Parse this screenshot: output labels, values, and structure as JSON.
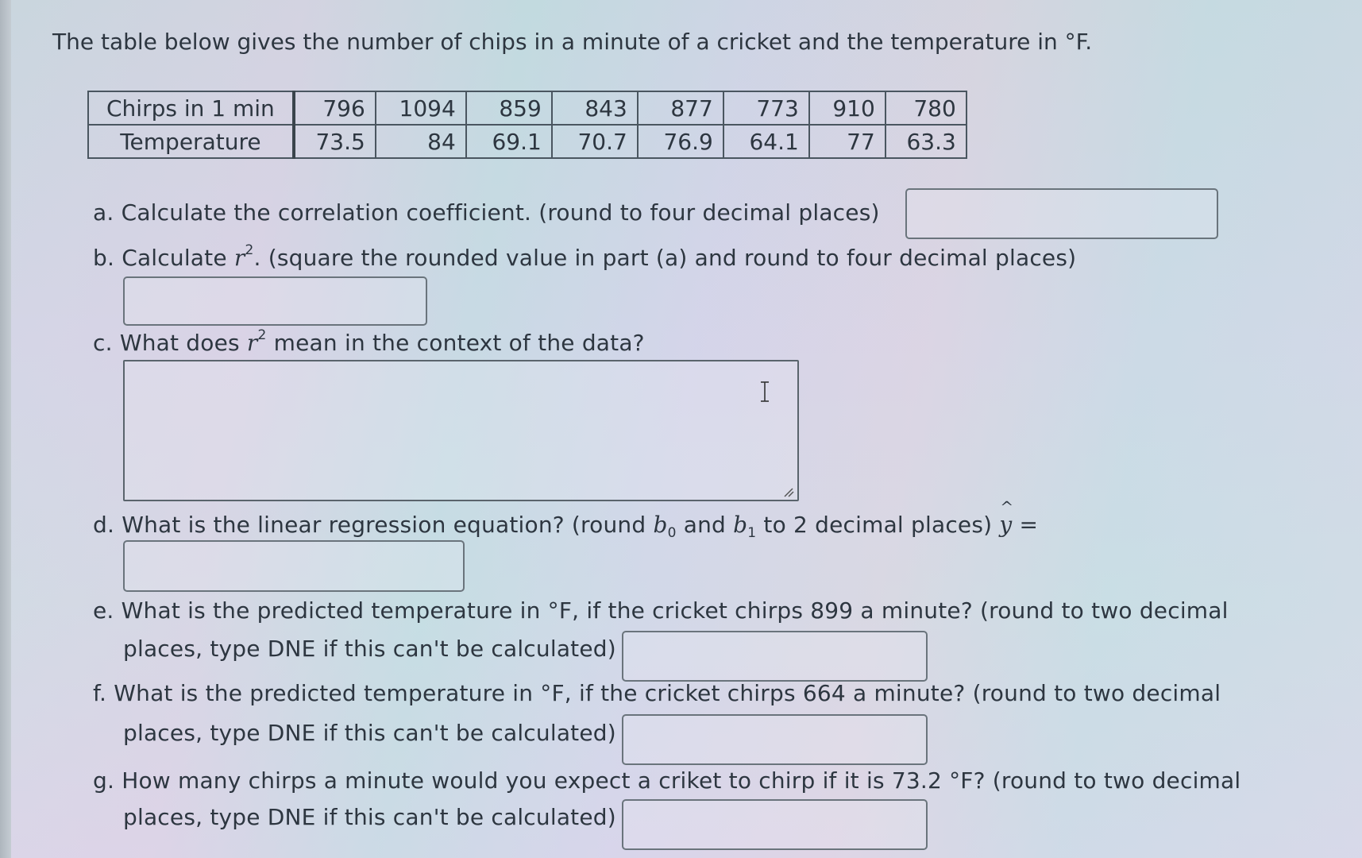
{
  "intro": "The table below gives the number of chips in a minute of a cricket and the temperature in °F.",
  "table": {
    "rows": [
      {
        "label": "Chirps in 1 min",
        "values": [
          "796",
          "1094",
          "859",
          "843",
          "877",
          "773",
          "910",
          "780"
        ]
      },
      {
        "label": "Temperature",
        "values": [
          "73.5",
          "84",
          "69.1",
          "70.7",
          "76.9",
          "64.1",
          "77",
          "63.3"
        ]
      }
    ]
  },
  "questions": {
    "a": {
      "prefix": "a.",
      "text": "Calculate the correlation coefficient. (round to four decimal places)",
      "value": ""
    },
    "b": {
      "prefix": "b.",
      "text_before": "Calculate",
      "var": "r",
      "sup": "2",
      "text_after": ". (square the rounded value in part (a) and round to four decimal places)",
      "value": ""
    },
    "c": {
      "prefix": "c.",
      "text_before": "What does",
      "var": "r",
      "sup": "2",
      "text_after": "mean in the context of the data?",
      "value": ""
    },
    "d": {
      "prefix": "d.",
      "text_before": "What is the linear regression equation? (round",
      "b0_var": "b",
      "b0_sub": "0",
      "and": "and",
      "b1_var": "b",
      "b1_sub": "1",
      "text_after": "to 2 decimal places)",
      "yhat_var": "y",
      "yhat_hat": "^",
      "equals": "=",
      "value": ""
    },
    "e": {
      "prefix": "e.",
      "line1": "What is the predicted temperature in °F, if the cricket chirps 899 a minute? (round to two decimal",
      "line2": "places, type DNE if this can't be calculated)",
      "value": ""
    },
    "f": {
      "prefix": "f.",
      "line1": "What is the predicted temperature in °F, if the cricket chirps 664 a minute? (round to two decimal",
      "line2": "places, type DNE if this can't be calculated)",
      "value": ""
    },
    "g": {
      "prefix": "g.",
      "line1": "How many chirps a minute would you expect a criket to chirp if it is 73.2 °F? (round to two decimal",
      "line2": "places, type DNE if this can't be calculated)",
      "value": ""
    }
  },
  "icons": {
    "text_cursor": "text-cursor-icon",
    "resize": "resize-handle-icon"
  }
}
